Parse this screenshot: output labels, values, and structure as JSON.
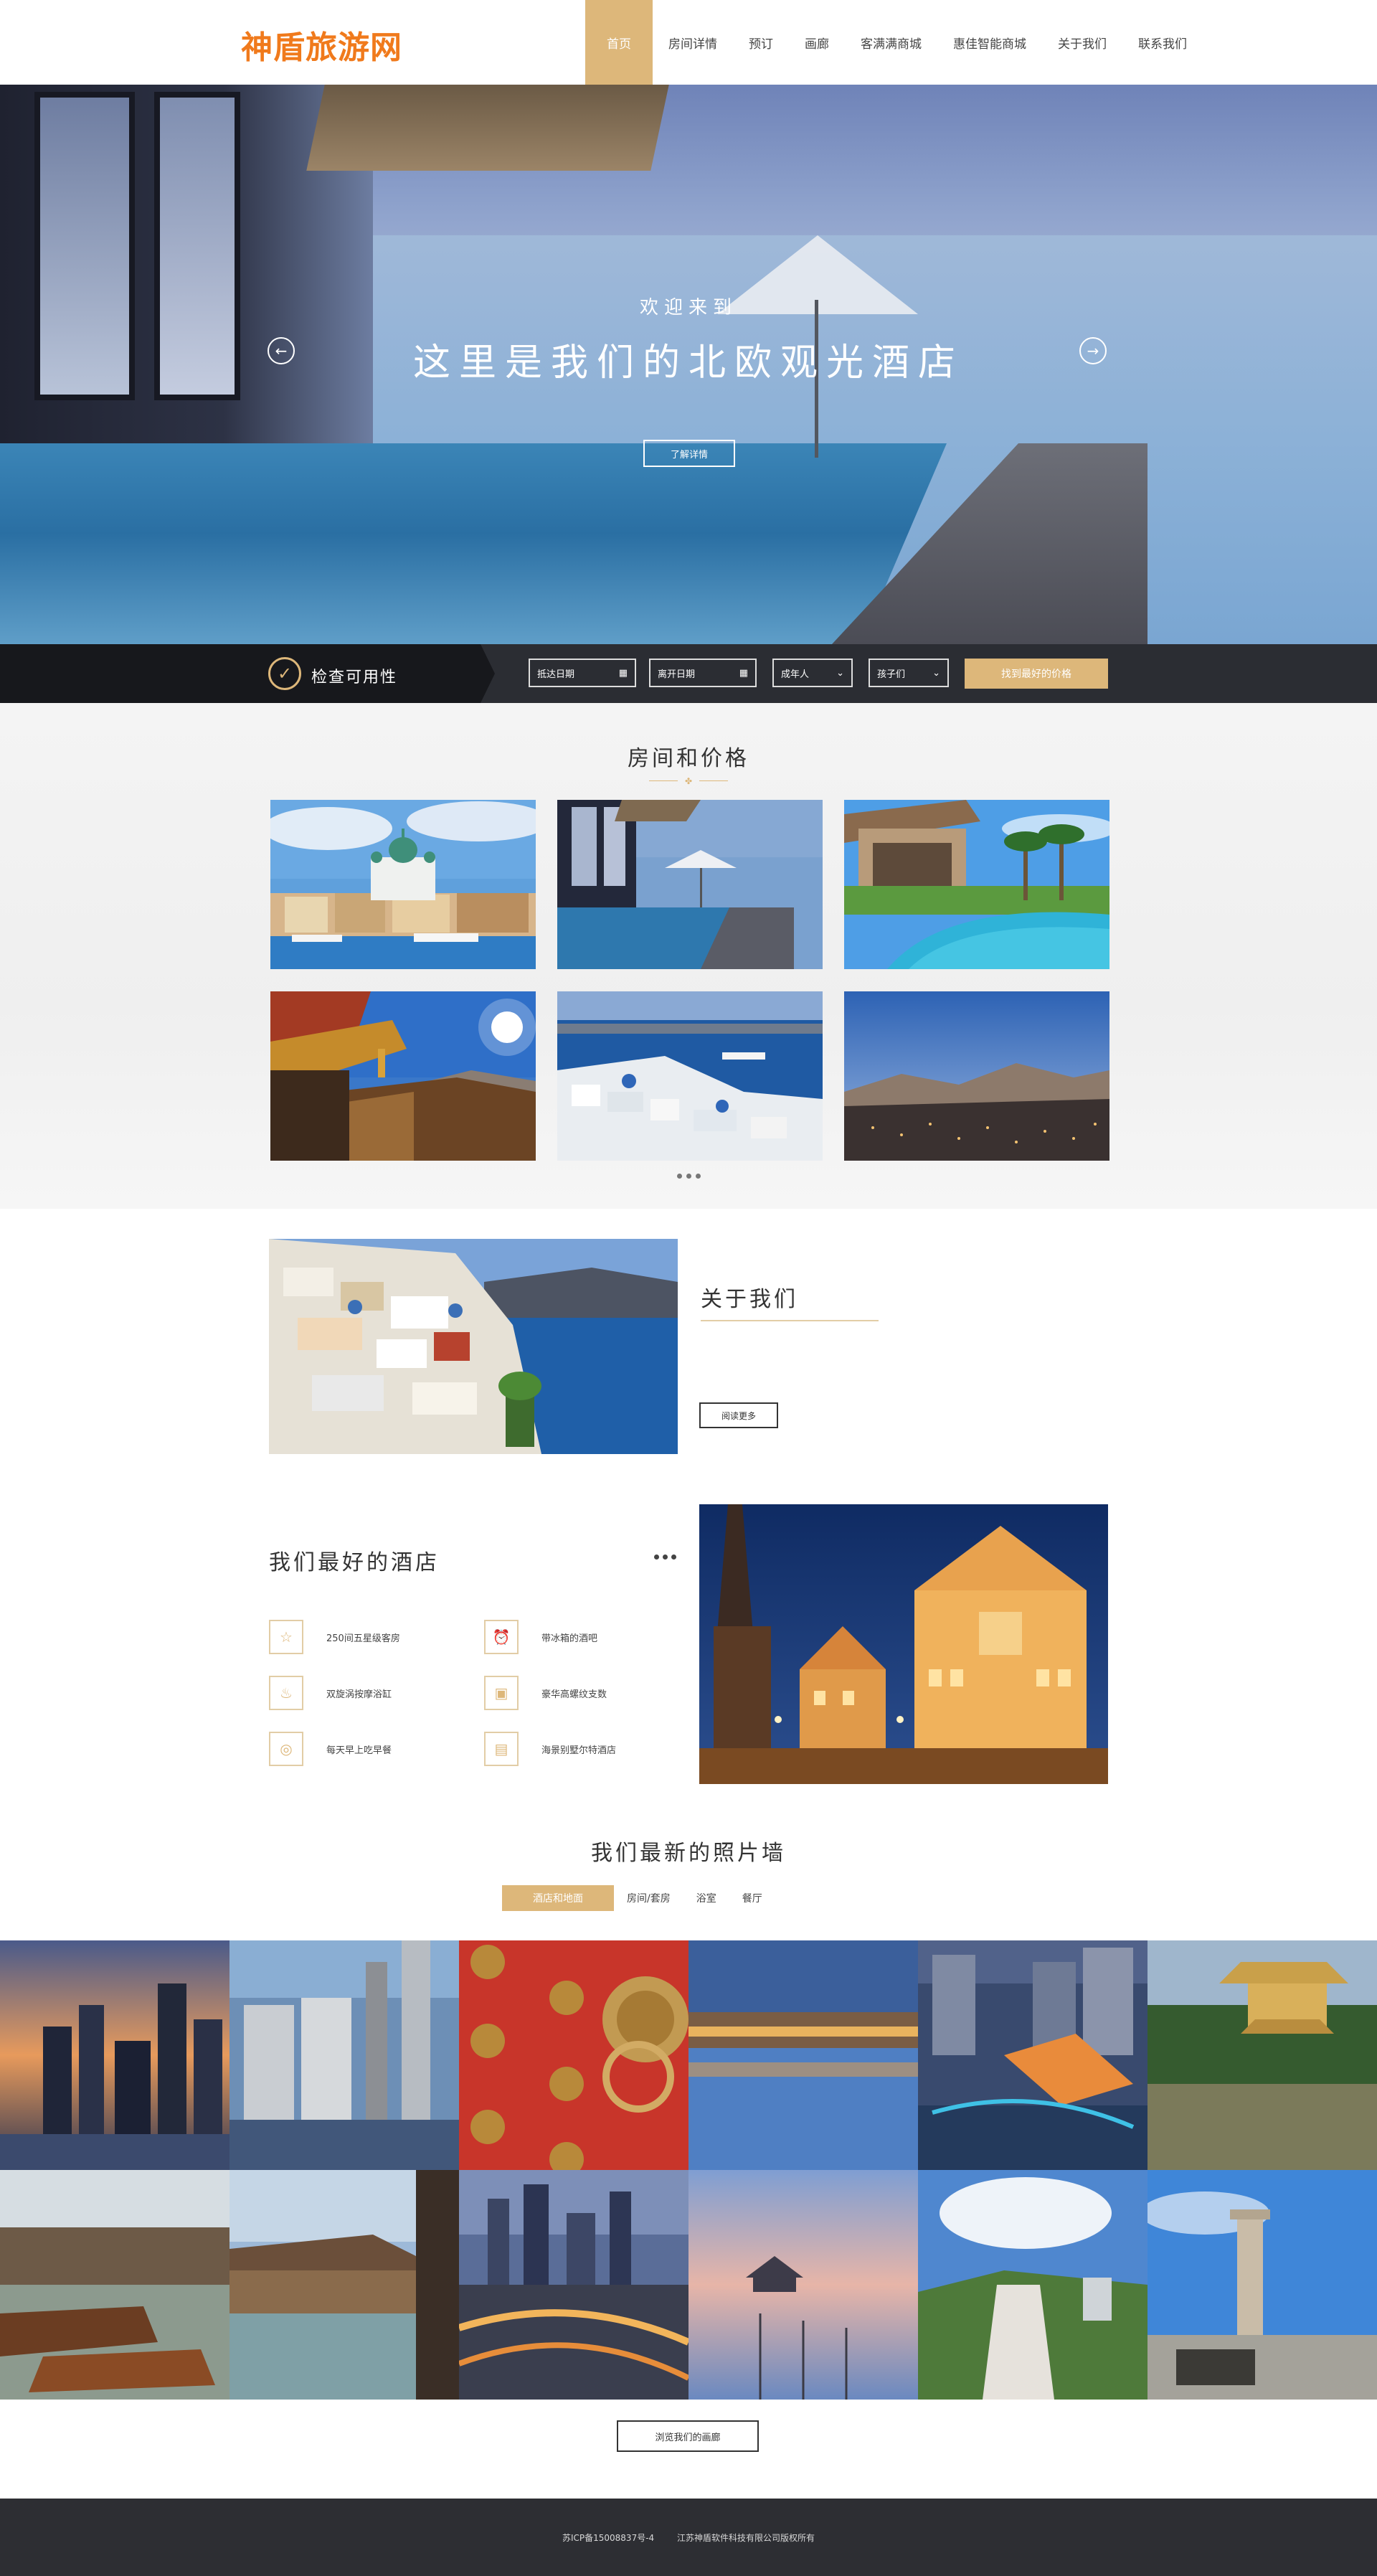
{
  "header": {
    "logo": "神盾旅游网",
    "nav": [
      "首页",
      "房间详情",
      "预订",
      "画廊",
      "客满满商城",
      "惠佳智能商城",
      "关于我们",
      "联系我们"
    ]
  },
  "hero": {
    "welcome": "欢迎来到",
    "title": "这里是我们的北欧观光酒店",
    "button": "了解详情",
    "prev_icon": "←",
    "next_icon": "→"
  },
  "availability": {
    "label": "检查可用性",
    "check_icon": "✓",
    "checkin": "抵达日期",
    "checkout": "离开日期",
    "adults": "成年人",
    "children": "孩子们",
    "calendar_icon": "▦",
    "chevron_icon": "⌄",
    "submit": "找到最好的价格"
  },
  "rooms": {
    "title": "房间和价格",
    "ornament": "✤"
  },
  "about": {
    "title": "关于我们",
    "button": "阅读更多"
  },
  "best": {
    "title": "我们最好的酒店",
    "features": [
      {
        "label": "250间五星级客房",
        "icon": "☆"
      },
      {
        "label": "带冰箱的酒吧",
        "icon": "⏰"
      },
      {
        "label": "双旋涡按摩浴缸",
        "icon": "♨"
      },
      {
        "label": "豪华高螺纹支数",
        "icon": "▣"
      },
      {
        "label": "每天早上吃早餐",
        "icon": "◎"
      },
      {
        "label": "海景别墅尔特酒店",
        "icon": "▤"
      }
    ]
  },
  "wall": {
    "title": "我们最新的照片墙",
    "tabs": [
      "酒店和地面",
      "房间/套房",
      "浴室",
      "餐厅"
    ],
    "button": "浏览我们的画廊"
  },
  "footer": {
    "icp": "苏ICP备15008837号-4",
    "copyright": "江苏神盾软件科技有限公司版权所有"
  }
}
